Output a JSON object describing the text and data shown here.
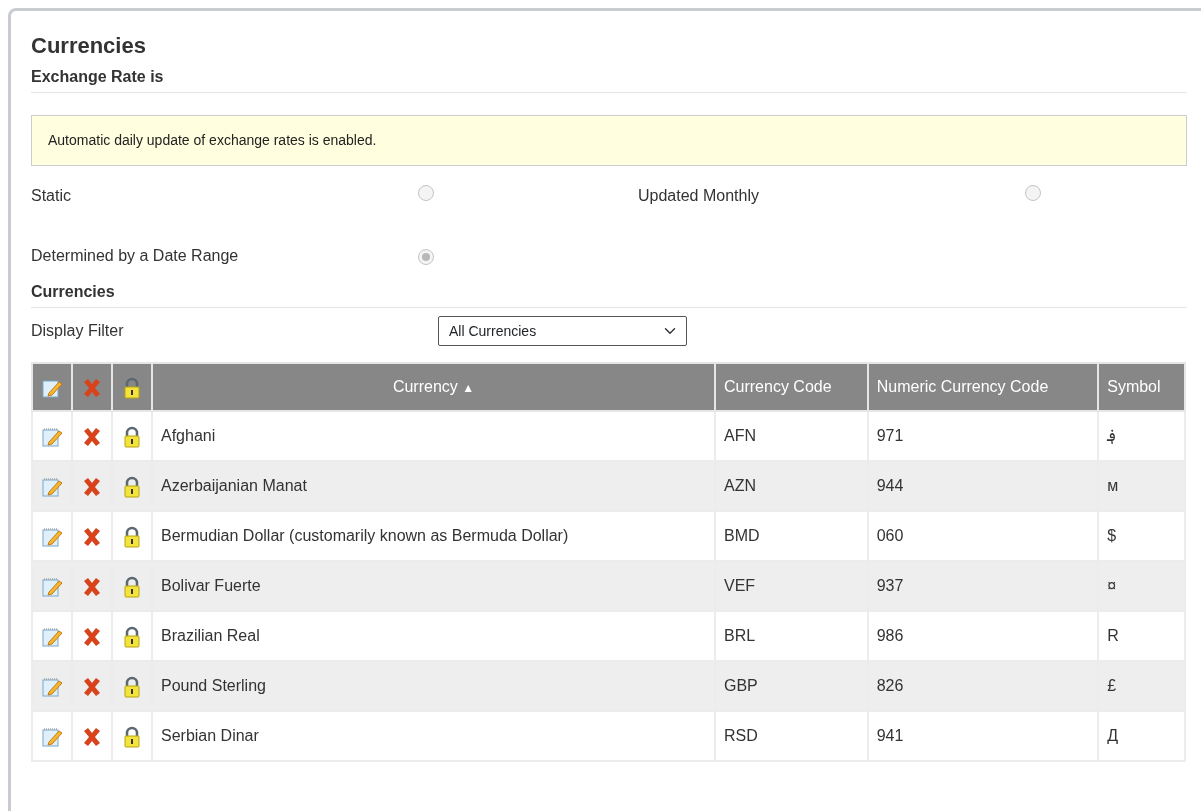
{
  "title": "Currencies",
  "exchange_section": {
    "heading": "Exchange Rate is",
    "notice": "Automatic daily update of exchange rates is enabled.",
    "options": [
      {
        "label": "Static",
        "selected": false,
        "disabled": true
      },
      {
        "label": "Updated Monthly",
        "selected": false,
        "disabled": true
      },
      {
        "label": "Determined by a Date Range",
        "selected": true,
        "disabled": true
      }
    ]
  },
  "currencies_section": {
    "heading": "Currencies",
    "filter": {
      "label": "Display Filter",
      "value": "All Currencies"
    }
  },
  "table": {
    "columns": [
      {
        "label": "Currency",
        "sort_indicator": "▲"
      },
      {
        "label": "Currency Code"
      },
      {
        "label": "Numeric Currency Code"
      },
      {
        "label": "Symbol"
      }
    ],
    "rows": [
      [
        "Afghani",
        "AFN",
        "971",
        "؋"
      ],
      [
        "Azerbaijanian Manat",
        "AZN",
        "944",
        "м"
      ],
      [
        "Bermudian Dollar (customarily known as Bermuda Dollar)",
        "BMD",
        "060",
        "$"
      ],
      [
        "Bolivar Fuerte",
        "VEF",
        "937",
        "¤"
      ],
      [
        "Brazilian Real",
        "BRL",
        "986",
        "R"
      ],
      [
        "Pound Sterling",
        "GBP",
        "826",
        "£"
      ],
      [
        "Serbian Dinar",
        "RSD",
        "941",
        "Д"
      ]
    ]
  }
}
